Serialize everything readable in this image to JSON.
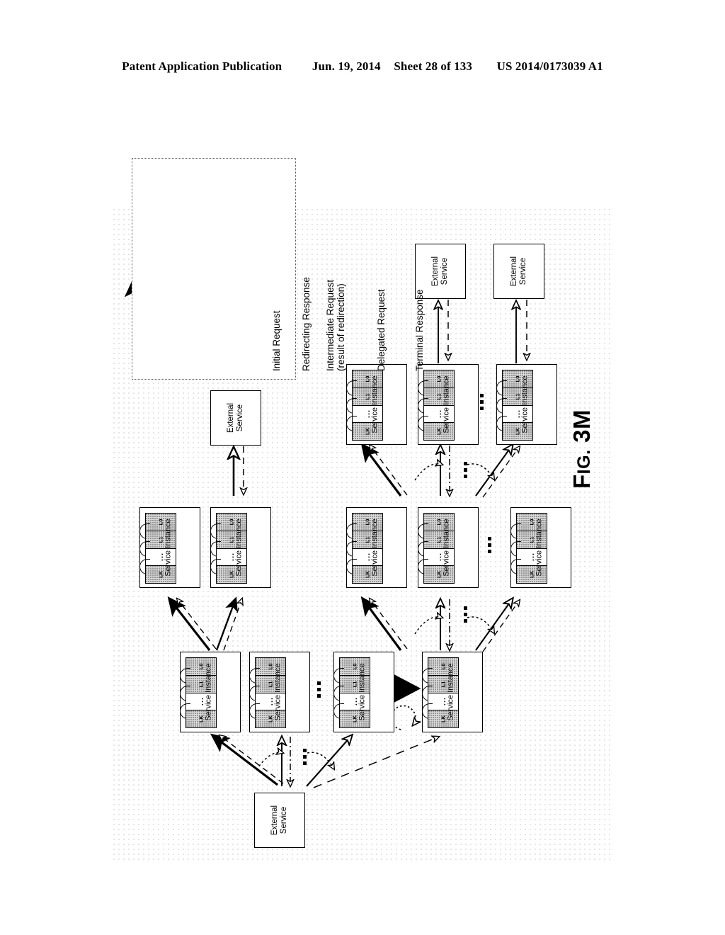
{
  "header": {
    "publication": "Patent Application Publication",
    "date": "Jun. 19, 2014",
    "sheet": "Sheet 28 of 133",
    "patent_number": "US 2014/0173039 A1"
  },
  "figure": {
    "label_prefix": "F",
    "label_rest": "IG.",
    "label_number": "3M",
    "full_label": "FIG. 3M"
  },
  "legend": {
    "items": [
      {
        "label": "Initial Request",
        "sublabel": "",
        "arrow": "thick-solid-filled-head"
      },
      {
        "label": "Redirecting Response",
        "sublabel": "",
        "arrow": "dash-dot-hollow-head"
      },
      {
        "label": "Intermediate Request",
        "sublabel": "(result of redirection)",
        "arrow": "thin-solid-hollow-head"
      },
      {
        "label": "Delegated Request",
        "sublabel": "",
        "arrow": "beaded-solid-triangle"
      },
      {
        "label": "Terminal Response",
        "sublabel": "",
        "arrow": "long-dash-hollow-head"
      }
    ]
  },
  "nodes": {
    "external_service_label_line1": "External",
    "external_service_label_line2": "Service",
    "service_instance_label": "Service Instance",
    "layers": [
      "L0",
      "L1",
      "...",
      "LK"
    ],
    "external_services": [
      {
        "id": "ext-top-a",
        "label": "External Service"
      },
      {
        "id": "ext-top-b",
        "label": "External Service"
      },
      {
        "id": "ext-mid",
        "label": "External Service"
      },
      {
        "id": "ext-bottom",
        "label": "External Service"
      }
    ],
    "service_instances": [
      {
        "id": "si-col1-a"
      },
      {
        "id": "si-col1-b"
      },
      {
        "id": "si-col2-a"
      },
      {
        "id": "si-col2-b"
      },
      {
        "id": "si-col2-c"
      },
      {
        "id": "si-col3-a"
      },
      {
        "id": "si-col3-b"
      },
      {
        "id": "si-col3-c"
      },
      {
        "id": "si-col4-a"
      },
      {
        "id": "si-col4-b"
      },
      {
        "id": "si-col4-c"
      },
      {
        "id": "si-col4-d"
      }
    ]
  },
  "colors": {
    "line": "#000000",
    "layer_fill": "#d8d8d8",
    "background": "#ffffff",
    "halftone": "rgba(0,0,0,0.11)"
  }
}
